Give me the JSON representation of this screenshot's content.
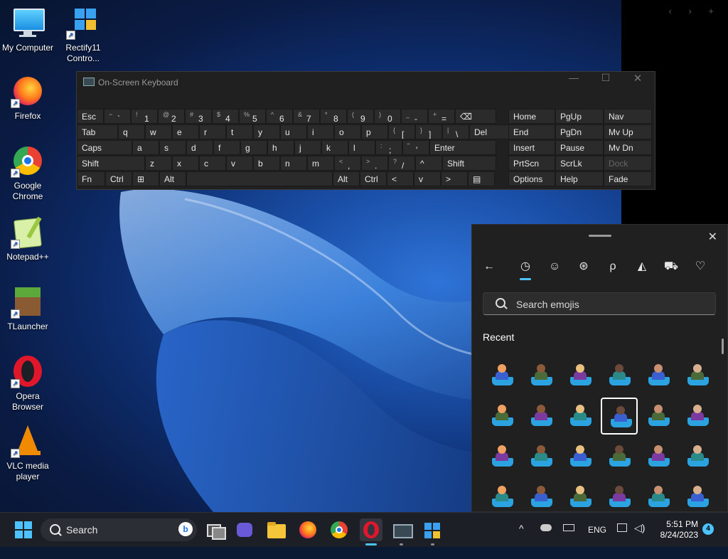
{
  "desktop": {
    "icons": [
      {
        "label": "My Computer"
      },
      {
        "label": "Rectify11 Contro..."
      },
      {
        "label": "Firefox"
      },
      {
        "label": "Google Chrome"
      },
      {
        "label": "Notepad++"
      },
      {
        "label": "TLauncher"
      },
      {
        "label": "Opera Browser"
      },
      {
        "label": "VLC media player"
      }
    ]
  },
  "osk": {
    "title": "On-Screen Keyboard",
    "rows": [
      [
        {
          "label": "Esc"
        },
        {
          "sub": "~",
          "main": "`"
        },
        {
          "sub": "!",
          "main": "1"
        },
        {
          "sub": "@",
          "main": "2"
        },
        {
          "sub": "#",
          "main": "3"
        },
        {
          "sub": "$",
          "main": "4"
        },
        {
          "sub": "%",
          "main": "5"
        },
        {
          "sub": "^",
          "main": "6"
        },
        {
          "sub": "&",
          "main": "7"
        },
        {
          "sub": "*",
          "main": "8"
        },
        {
          "sub": "(",
          "main": "9"
        },
        {
          "sub": ")",
          "main": "0"
        },
        {
          "sub": "_",
          "main": "-"
        },
        {
          "sub": "+",
          "main": "="
        },
        {
          "label": "⌫"
        }
      ],
      [
        {
          "label": "Tab"
        },
        {
          "label": "q"
        },
        {
          "label": "w"
        },
        {
          "label": "e"
        },
        {
          "label": "r"
        },
        {
          "label": "t"
        },
        {
          "label": "y"
        },
        {
          "label": "u"
        },
        {
          "label": "i"
        },
        {
          "label": "o"
        },
        {
          "label": "p"
        },
        {
          "sub": "{",
          "main": "["
        },
        {
          "sub": "}",
          "main": "]"
        },
        {
          "sub": "|",
          "main": "\\"
        },
        {
          "label": "Del"
        }
      ],
      [
        {
          "label": "Caps"
        },
        {
          "label": "a"
        },
        {
          "label": "s"
        },
        {
          "label": "d"
        },
        {
          "label": "f"
        },
        {
          "label": "g"
        },
        {
          "label": "h"
        },
        {
          "label": "j"
        },
        {
          "label": "k"
        },
        {
          "label": "l"
        },
        {
          "sub": ":",
          "main": ";"
        },
        {
          "sub": "\"",
          "main": "'"
        },
        {
          "label": "Enter"
        }
      ],
      [
        {
          "label": "Shift"
        },
        {
          "label": "z"
        },
        {
          "label": "x"
        },
        {
          "label": "c"
        },
        {
          "label": "v"
        },
        {
          "label": "b"
        },
        {
          "label": "n"
        },
        {
          "label": "m"
        },
        {
          "sub": "<",
          "main": ","
        },
        {
          "sub": ">",
          "main": "."
        },
        {
          "sub": "?",
          "main": "/"
        },
        {
          "label": "^"
        },
        {
          "label": "Shift"
        }
      ],
      [
        {
          "label": "Fn"
        },
        {
          "label": "Ctrl"
        },
        {
          "label": "⊞"
        },
        {
          "label": "Alt"
        },
        {
          "label": ""
        },
        {
          "label": "Alt"
        },
        {
          "label": "Ctrl"
        },
        {
          "label": "<"
        },
        {
          "label": "v"
        },
        {
          "label": ">"
        },
        {
          "label": "▤"
        }
      ]
    ],
    "nav_rows": [
      [
        "Home",
        "PgUp",
        "Nav"
      ],
      [
        "End",
        "PgDn",
        "Mv Up"
      ],
      [
        "Insert",
        "Pause",
        "Mv Dn"
      ],
      [
        "PrtScn",
        "ScrLk",
        "Dock"
      ],
      [
        "Options",
        "Help",
        "Fade"
      ]
    ]
  },
  "emoji_panel": {
    "search_placeholder": "Search emojis",
    "section": "Recent",
    "tabs": [
      "back",
      "recent",
      "smiley",
      "gif",
      "kaomoji",
      "symbols",
      "vehicles",
      "favorites"
    ]
  },
  "taskbar": {
    "search_label": "Search",
    "language": "ENG",
    "time": "5:51 PM",
    "date": "8/24/2023",
    "notifications": "4"
  },
  "colors": {
    "accent": "#4cc2ff",
    "water": "#2aa3e0",
    "panel": "#202020"
  }
}
